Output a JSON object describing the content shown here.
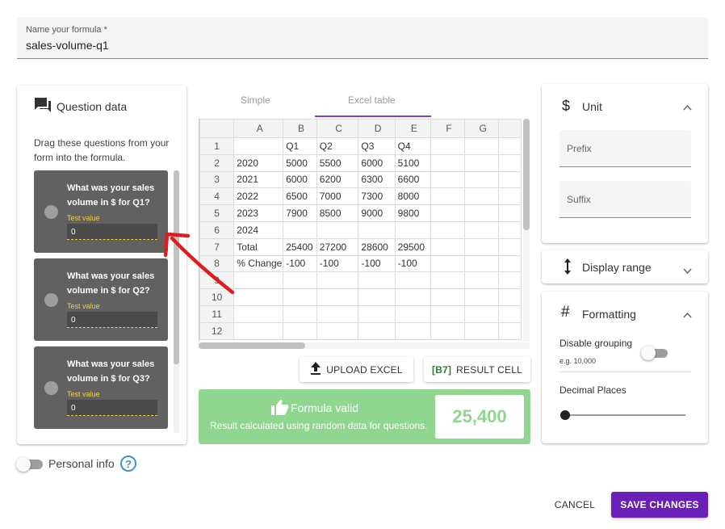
{
  "formula_name": {
    "label": "Name your formula *",
    "value": "sales-volume-q1"
  },
  "question_data": {
    "title": "Question data",
    "help": "Drag these questions from your form into the formula.",
    "questions": [
      {
        "text": "What was your sales volume in $ for Q1?",
        "test_label": "Test value",
        "test_value": "0"
      },
      {
        "text": "What was your sales volume in $ for Q2?",
        "test_label": "Test value",
        "test_value": "0"
      },
      {
        "text": "What was your sales volume in $ for Q3?",
        "test_label": "Test value",
        "test_value": "0"
      }
    ]
  },
  "tabs": [
    {
      "label": "Simple",
      "active": false
    },
    {
      "label": "Excel table",
      "active": true
    }
  ],
  "sheet": {
    "columns": [
      "A",
      "B",
      "C",
      "D",
      "E",
      "F",
      "G",
      ""
    ],
    "rows": [
      [
        "",
        "Q1",
        "Q2",
        "Q3",
        "Q4",
        "",
        "",
        ""
      ],
      [
        "2020",
        "5000",
        "5500",
        "6000",
        "5100",
        "",
        "",
        ""
      ],
      [
        "2021",
        "6000",
        "6200",
        "6300",
        "6600",
        "",
        "",
        ""
      ],
      [
        "2022",
        "6500",
        "7000",
        "7300",
        "8000",
        "",
        "",
        ""
      ],
      [
        "2023",
        "7900",
        "8500",
        "9000",
        "9800",
        "",
        "",
        ""
      ],
      [
        "2024",
        "",
        "",
        "",
        "",
        "",
        "",
        ""
      ],
      [
        "Total",
        "25400",
        "27200",
        "28600",
        "29500",
        "",
        "",
        ""
      ],
      [
        "% Change",
        "-100",
        "-100",
        "-100",
        "-100",
        "",
        "",
        ""
      ],
      [
        "",
        "",
        "",
        "",
        "",
        "",
        "",
        ""
      ],
      [
        "",
        "",
        "",
        "",
        "",
        "",
        "",
        ""
      ],
      [
        "",
        "",
        "",
        "",
        "",
        "",
        "",
        ""
      ],
      [
        "",
        "",
        "",
        "",
        "",
        "",
        "",
        ""
      ]
    ],
    "row_numbers": [
      "1",
      "2",
      "3",
      "4",
      "5",
      "6",
      "7",
      "8",
      "9",
      "10",
      "11",
      "12"
    ]
  },
  "actions": {
    "upload": "UPLOAD EXCEL",
    "result_cell_ref": "[B7]",
    "result_cell": "RESULT CELL"
  },
  "validation": {
    "title": "Formula valid",
    "subtitle": "Result calculated using random data for questions.",
    "result": "25,400",
    "color": "#90d690"
  },
  "unit": {
    "title": "Unit",
    "prefix_placeholder": "Prefix",
    "suffix_placeholder": "Suffix"
  },
  "display_range": {
    "title": "Display range"
  },
  "formatting": {
    "title": "Formatting",
    "disable_grouping": "Disable grouping",
    "grouping_example": "e.g. 10,000",
    "decimal_places": "Decimal Places",
    "decimal_value": 0
  },
  "personal_info": {
    "label": "Personal info"
  },
  "footer": {
    "cancel": "CANCEL",
    "save": "SAVE CHANGES",
    "accent": "#6a1fb8"
  }
}
